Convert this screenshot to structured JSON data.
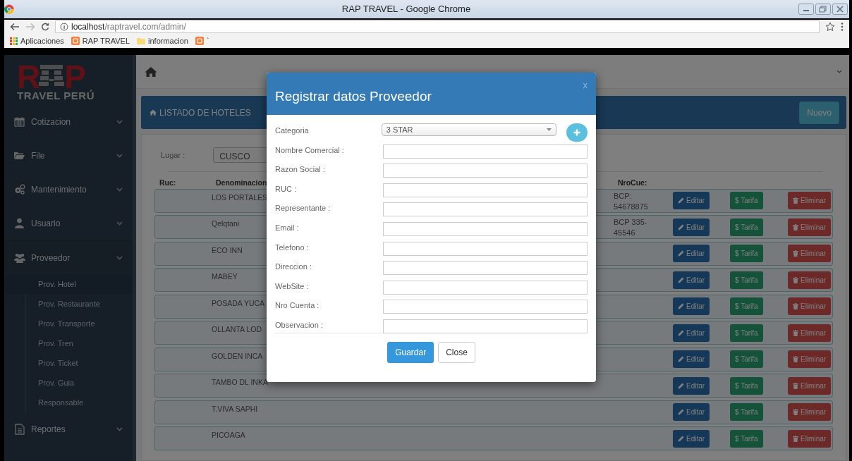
{
  "browser": {
    "title": "RAP TRAVEL - Google Chrome",
    "url_host": "localhost",
    "url_path": "/raptravel.com/admin/",
    "bookmarks": [
      {
        "label": "Aplicaciones"
      },
      {
        "label": "RAP TRAVEL"
      },
      {
        "label": "informacion"
      },
      {
        "label": "`"
      }
    ]
  },
  "sidebar": {
    "logo": {
      "left": "R",
      "right": "P",
      "subtitle": "TRAVEL PERÚ"
    },
    "items": [
      {
        "label": "Cotizacion",
        "expanded": false
      },
      {
        "label": "File",
        "expanded": false
      },
      {
        "label": "Mantenimiento",
        "expanded": false
      },
      {
        "label": "Usuario",
        "expanded": false
      },
      {
        "label": "Proveedor",
        "expanded": true,
        "children": [
          {
            "label": "Prov. Hotel",
            "selected": true
          },
          {
            "label": "Prov. Restaurante",
            "selected": false
          },
          {
            "label": "Prov. Transporte",
            "selected": false
          },
          {
            "label": "Prov. Tren",
            "selected": false
          },
          {
            "label": "Prov. Ticket",
            "selected": false
          },
          {
            "label": "Prov. Guia",
            "selected": false
          },
          {
            "label": "Responsable",
            "selected": false
          }
        ]
      },
      {
        "label": "Reportes",
        "expanded": false
      }
    ]
  },
  "panel": {
    "title": "LISTADO DE HOTELES",
    "new_button": "Nuevo"
  },
  "filter": {
    "label": "Lugar :",
    "value": "CUSCO"
  },
  "table": {
    "columns": [
      "Ruc:",
      "Denominacion",
      "NroCue:"
    ],
    "rows": [
      {
        "denominacion": "LOS PORTALES",
        "nrocue": "BCP: 54678875",
        "actions": [
          "Editar",
          "$ Tarifa",
          "Eliminar"
        ]
      },
      {
        "denominacion": "Qelqtani",
        "nrocue": "BCP 335-45546",
        "actions": [
          "Editar",
          "$ Tarifa",
          "Eliminar"
        ]
      },
      {
        "denominacion": "ECO INN",
        "actions": [
          "Editar",
          "$ Tarifa",
          "Eliminar"
        ]
      },
      {
        "denominacion": "MABEY",
        "actions": [
          "Editar",
          "$ Tarifa",
          "Eliminar"
        ]
      },
      {
        "denominacion": "POSADA YUCA",
        "actions": [
          "Editar",
          "$ Tarifa",
          "Eliminar"
        ]
      },
      {
        "denominacion": "OLLANTA LOD",
        "actions": [
          "Editar",
          "$ Tarifa",
          "Eliminar"
        ]
      },
      {
        "denominacion": "GOLDEN INCA",
        "actions": [
          "Editar",
          "$ Tarifa",
          "Eliminar"
        ]
      },
      {
        "denominacion": "TAMBO DL INKA",
        "actions": [
          "Editar",
          "$ Tarifa",
          "Eliminar"
        ]
      },
      {
        "denominacion": "T.VIVA SAPHI",
        "actions": [
          "Editar",
          "$ Tarifa",
          "Eliminar"
        ]
      },
      {
        "denominacion": "PICOAGA",
        "actions": [
          "Editar",
          "$ Tarifa",
          "Eliminar"
        ]
      }
    ]
  },
  "modal": {
    "title": "Registrar datos Proveedor",
    "close": "x",
    "fields": [
      {
        "label": "Categoria",
        "kind": "select",
        "value": "3 STAR"
      },
      {
        "label": "Nombre Comercial :",
        "kind": "text"
      },
      {
        "label": "Razon Social :",
        "kind": "text"
      },
      {
        "label": "RUC :",
        "kind": "text"
      },
      {
        "label": "Representante :",
        "kind": "text"
      },
      {
        "label": "Email :",
        "kind": "text"
      },
      {
        "label": "Telefono :",
        "kind": "text"
      },
      {
        "label": "Direccion :",
        "kind": "text"
      },
      {
        "label": "WebSite :",
        "kind": "text"
      },
      {
        "label": "Nro Cuenta :",
        "kind": "text"
      },
      {
        "label": "Observacion :",
        "kind": "text"
      }
    ],
    "buttons": [
      "Guardar",
      "Close"
    ]
  }
}
